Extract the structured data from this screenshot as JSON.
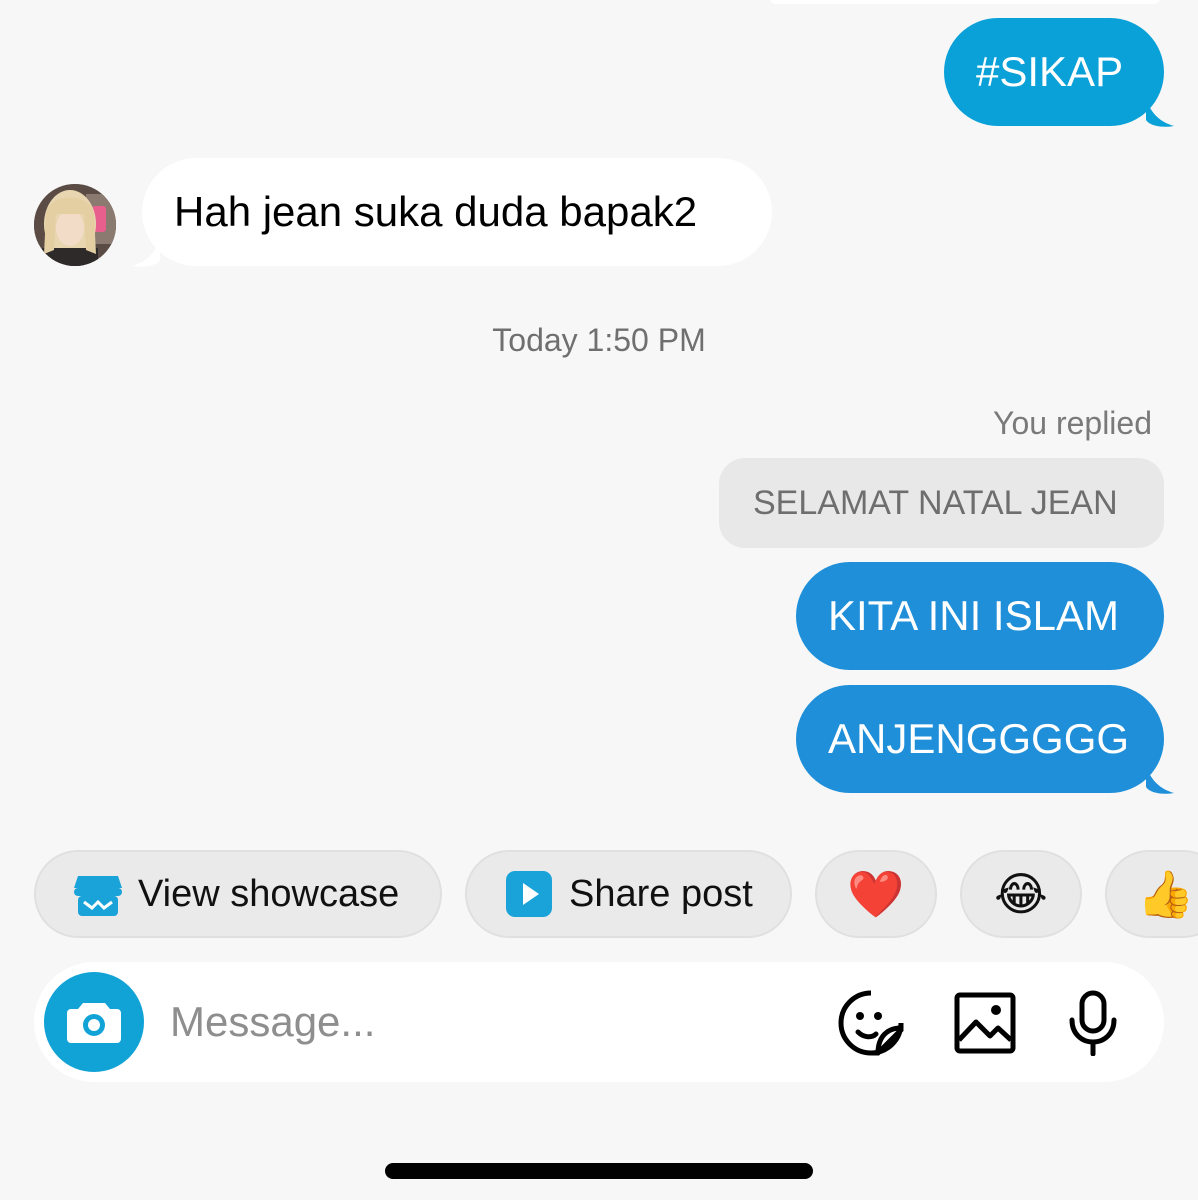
{
  "thread": {
    "messages": [
      {
        "from": "me",
        "text": "#SIKAP"
      },
      {
        "from": "them",
        "text": "Hah jean suka duda bapak2"
      }
    ],
    "timestamp": "Today 1:50 PM",
    "reply": {
      "label": "You replied",
      "quoted_text": "SELAMAT NATAL JEAN",
      "messages": [
        {
          "from": "me",
          "text": "KITA INI ISLAM"
        },
        {
          "from": "me",
          "text": "ANJENGGGGG"
        }
      ]
    }
  },
  "quick_actions": {
    "view_showcase": {
      "label": "View showcase",
      "icon": "storefront-icon"
    },
    "share_post": {
      "label": "Share post",
      "icon": "play-square-icon"
    },
    "reactions": [
      "❤️",
      "😂",
      "👍"
    ]
  },
  "composer": {
    "placeholder": "Message...",
    "icons": [
      "camera-icon",
      "sticker-icon",
      "gallery-icon",
      "microphone-icon"
    ]
  },
  "colors": {
    "outgoing_bubble": "#1e8fd8",
    "outgoing_bubble_first": "#0aa0d8",
    "incoming_bubble": "#ffffff",
    "quote_bubble": "#e8e8e8",
    "camera_button": "#12a3d6",
    "background": "#f7f7f7"
  }
}
